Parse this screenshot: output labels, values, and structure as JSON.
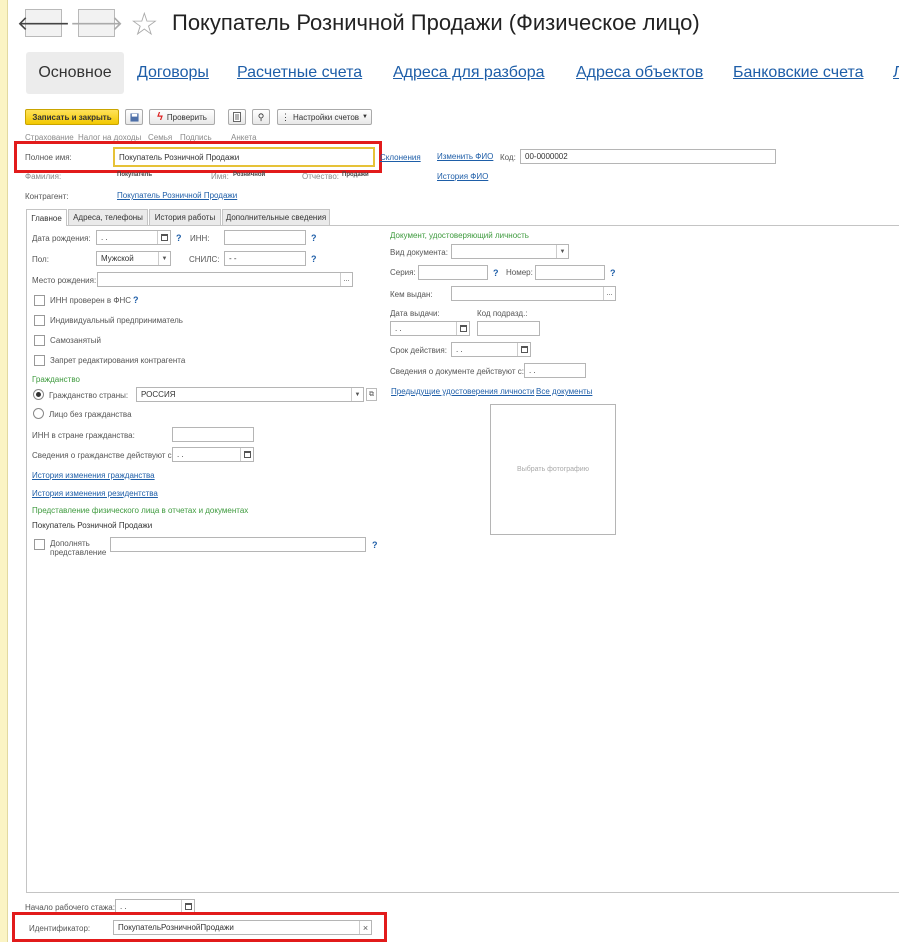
{
  "nav": {
    "back": "🡐",
    "forward": "🡒",
    "star": "☆"
  },
  "title": "Покупатель Розничной Продажи (Физическое лицо)",
  "tabs": [
    "Основное",
    "Договоры",
    "Расчетные счета",
    "Адреса для разбора",
    "Адреса объектов",
    "Банковские счета",
    "Л"
  ],
  "toolbar": {
    "save_close": "Записать и закрыть",
    "check": "Проверить",
    "settings": "Настройки счетов"
  },
  "links_row": [
    "Страхование",
    "Налог на доходы",
    "Семья",
    "Подпись",
    "Анкета"
  ],
  "full_name": {
    "label": "Полное имя:",
    "value": "Покупатель Розничной Продажи",
    "declension": "Склонения",
    "change_fio": "Изменить ФИО",
    "code_label": "Код:",
    "code_value": "00-0000002"
  },
  "fio": {
    "surname_label": "Фамилия:",
    "surname": "Покупатель",
    "name_label": "Имя:",
    "name": "Розничной",
    "patronymic_label": "Отчество:",
    "patronymic": "Продажи",
    "history": "История ФИО"
  },
  "counterparty": {
    "label": "Контрагент:",
    "value": "Покупатель Розничной Продажи"
  },
  "subtabs": [
    "Главное",
    "Адреса, телефоны",
    "История работы",
    "Дополнительные сведения"
  ],
  "main": {
    "birth_label": "Дата рождения:",
    "birth_value": ". .",
    "inn_label": "ИНН:",
    "gender_label": "Пол:",
    "gender_value": "Мужской",
    "snils_label": "СНИЛС:",
    "snils_value": "- -",
    "birthplace_label": "Место рождения:",
    "checks": [
      "ИНН проверен в ФНС",
      "Индивидуальный предприниматель",
      "Самозанятый",
      "Запрет редактирования контрагента"
    ],
    "citizenship_header": "Гражданство",
    "citizenship_country_label": "Гражданство страны:",
    "citizenship_country": "РОССИЯ",
    "stateless": "Лицо без гражданства",
    "inn_country_label": "ИНН в стране гражданства:",
    "citizenship_valid_label": "Сведения о гражданстве действуют с:",
    "citizenship_valid_value": ". .",
    "history_citizenship": "История изменения гражданства",
    "history_residency": "История изменения резидентства",
    "representation_header": "Представление физического лица в отчетах и документах",
    "representation_value": "Покупатель Розничной Продажи",
    "supplement_label_1": "Дополнять",
    "supplement_label_2": "представление"
  },
  "doc": {
    "header": "Документ, удостоверяющий личность",
    "type_label": "Вид документа:",
    "series_label": "Серия:",
    "number_label": "Номер:",
    "issued_by_label": "Кем выдан:",
    "issue_date_label": "Дата выдачи:",
    "issue_date_value": ". .",
    "dept_code_label": "Код подразд.:",
    "validity_label": "Срок действия:",
    "validity_value": ". .",
    "valid_from_label": "Сведения о документе действуют с:",
    "valid_from_value": ". .",
    "prev_docs": "Предыдущие удостоверения личности",
    "all_docs": "Все документы",
    "photo": "Выбрать фотографию"
  },
  "footer": {
    "work_start_label": "Начало рабочего стажа:",
    "work_start_value": ". .",
    "id_label": "Идентификатор:",
    "id_value": "ПокупательРозничнойПродажи",
    "clear": "×"
  },
  "colors": {
    "accent_link": "#1e5ea8",
    "save_button": "#f7d51e",
    "highlight": "#e21b1b",
    "green_header": "#3d9a3d"
  }
}
